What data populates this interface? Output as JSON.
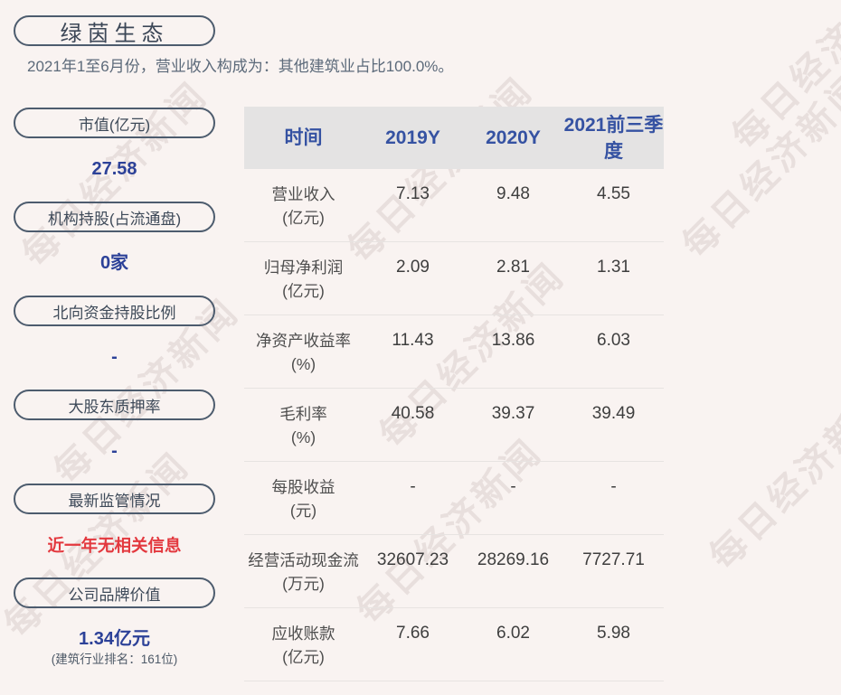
{
  "company": {
    "name": "绿茵生态",
    "subtitle": "2021年1至6月份，营业收入构成为：其他建筑业占比100.0%。"
  },
  "sidebar": {
    "items": [
      {
        "label": "市值(亿元)",
        "value": "27.58"
      },
      {
        "label": "机构持股(占流通盘)",
        "value": "0家"
      },
      {
        "label": "北向资金持股比例",
        "value": "-"
      },
      {
        "label": "大股东质押率",
        "value": "-"
      },
      {
        "label": "最新监管情况",
        "value": "近一年无相关信息"
      },
      {
        "label": "公司品牌价值",
        "value": "1.34亿元",
        "note": "(建筑行业排名：161位)"
      }
    ]
  },
  "table": {
    "headers": [
      "时间",
      "2019Y",
      "2020Y",
      "2021前三季度"
    ],
    "rows": [
      {
        "label": "营业收入",
        "unit": "(亿元)",
        "values": [
          "7.13",
          "9.48",
          "4.55"
        ]
      },
      {
        "label": "归母净利润",
        "unit": "(亿元)",
        "values": [
          "2.09",
          "2.81",
          "1.31"
        ]
      },
      {
        "label": "净资产收益率",
        "unit": "(%)",
        "values": [
          "11.43",
          "13.86",
          "6.03"
        ]
      },
      {
        "label": "毛利率",
        "unit": "(%)",
        "values": [
          "40.58",
          "39.37",
          "39.49"
        ]
      },
      {
        "label": "每股收益",
        "unit": "(元)",
        "values": [
          "-",
          "-",
          "-"
        ]
      },
      {
        "label": "经营活动现金流",
        "unit": "(万元)",
        "values": [
          "32607.23",
          "28269.16",
          "7727.71"
        ]
      },
      {
        "label": "应收账款",
        "unit": "(亿元)",
        "values": [
          "7.66",
          "6.02",
          "5.98"
        ]
      }
    ]
  },
  "watermark": {
    "text": "每日经济新闻"
  },
  "colors": {
    "page_background": "#f9f3f1",
    "accent_blue": "#2c4198",
    "header_blue": "#3552a2",
    "alert_red": "#e3383e",
    "pill_border": "#4d5c6e",
    "header_background": "#e4e3e3"
  }
}
